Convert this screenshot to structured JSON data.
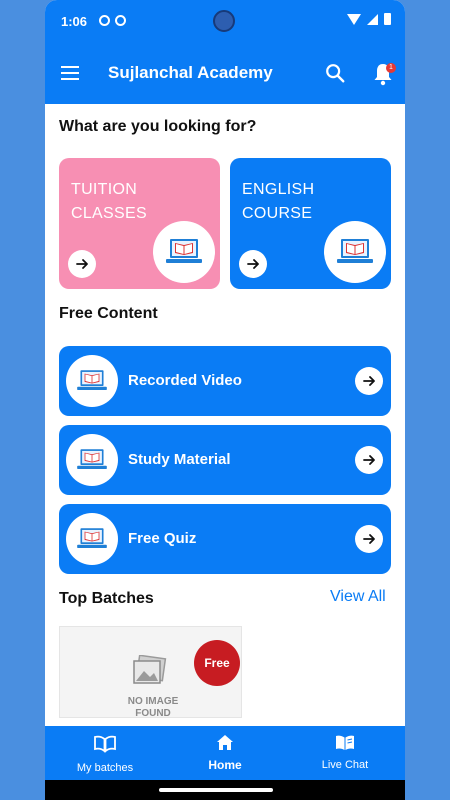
{
  "status_bar": {
    "time": "1:06"
  },
  "app_bar": {
    "title": "Sujlanchal Academy",
    "notification_count": "1"
  },
  "sections": {
    "looking_for": "What are you looking for?",
    "free_content": "Free Content",
    "top_batches": "Top Batches",
    "view_all": "View All"
  },
  "categories": [
    {
      "line1": "TUITION",
      "line2": "CLASSES",
      "color": "#f78fb3"
    },
    {
      "line1": "ENGLISH",
      "line2": "COURSE",
      "color": "#0a7cf5"
    }
  ],
  "free_content_items": [
    {
      "label": "Recorded Video"
    },
    {
      "label": "Study Material"
    },
    {
      "label": "Free Quiz"
    }
  ],
  "batch": {
    "badge": "Free",
    "placeholder_line1": "NO IMAGE",
    "placeholder_line2": "FOUND"
  },
  "bottom_nav": [
    {
      "label": "My batches",
      "icon": "book-open-icon"
    },
    {
      "label": "Home",
      "icon": "home-icon",
      "active": true
    },
    {
      "label": "Live Chat",
      "icon": "chat-book-icon"
    }
  ],
  "colors": {
    "primary": "#0a7cf5",
    "accent_pink": "#f78fb3",
    "badge_red": "#c71c22"
  }
}
